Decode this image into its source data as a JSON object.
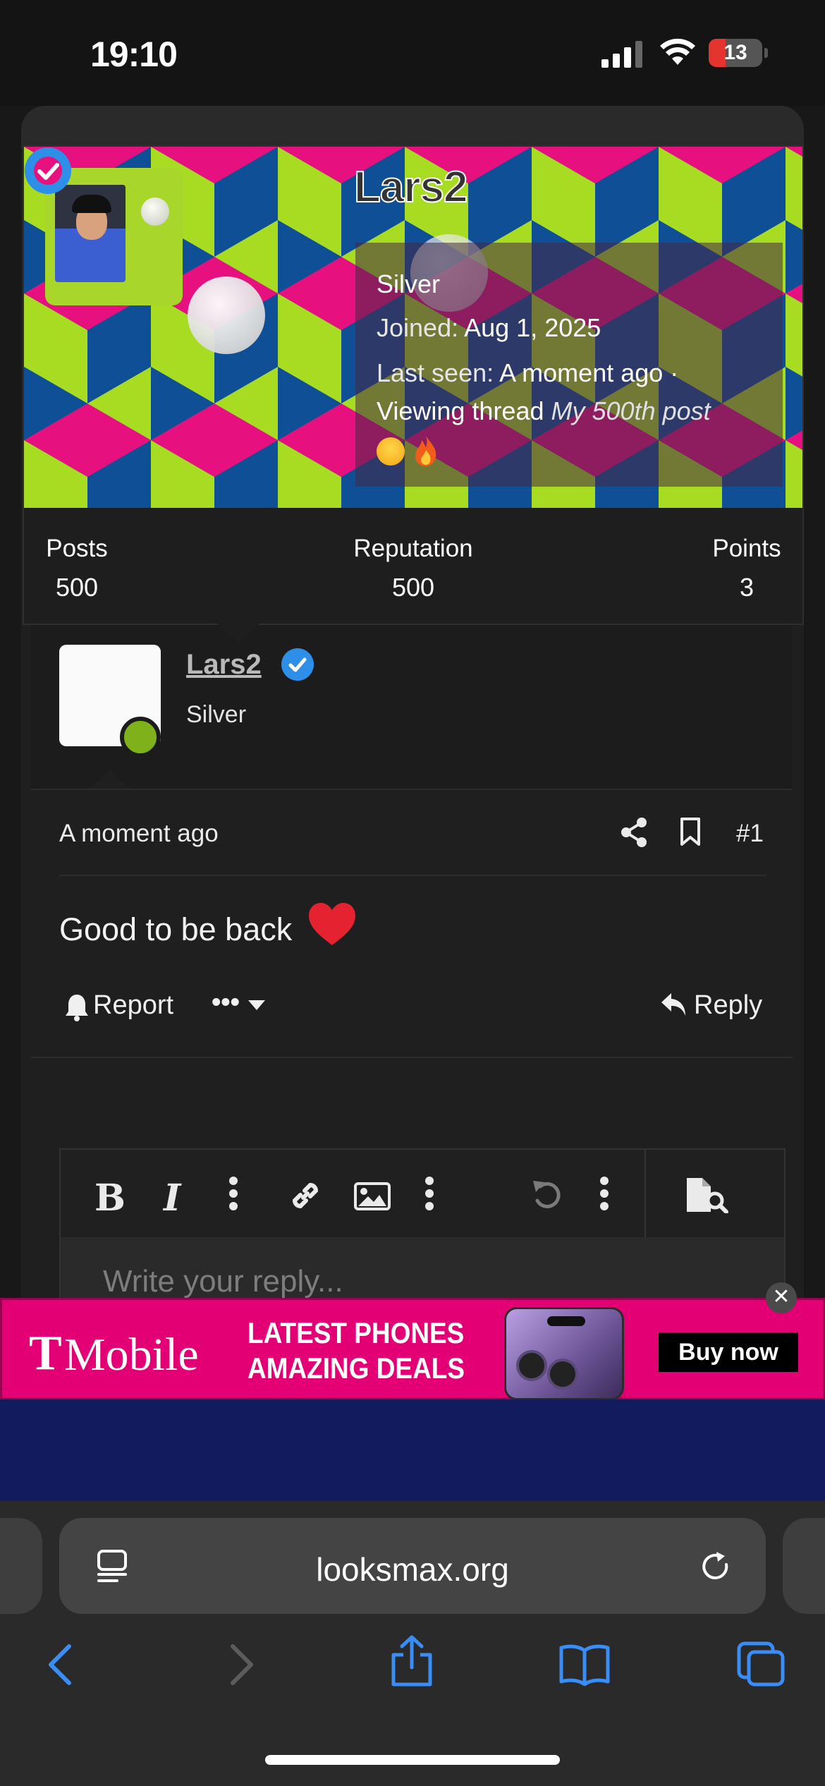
{
  "status_bar": {
    "time": "19:10",
    "battery": "13"
  },
  "profile_popup": {
    "username": "Lars2",
    "rank": "Silver",
    "joined_label": "Joined:",
    "joined_value": "Aug 1, 2025",
    "last_seen_label": "Last seen:",
    "last_seen_value": "A moment ago ·",
    "viewing_prefix": "Viewing thread",
    "viewing_thread": "My 500th post",
    "stats": [
      {
        "label": "Posts",
        "value": "500"
      },
      {
        "label": "Reputation",
        "value": "500"
      },
      {
        "label": "Points",
        "value": "3"
      }
    ],
    "colors": {
      "pink": "#e6117f",
      "lime": "#a8dc22",
      "blue": "#0e4f95"
    }
  },
  "post": {
    "username": "Lars2",
    "rank": "Silver",
    "time": "A moment ago",
    "number": "#1",
    "body": "Good to be back",
    "actions": {
      "report": "Report",
      "more": "•••",
      "reply": "Reply"
    }
  },
  "editor": {
    "placeholder": "Write your reply..."
  },
  "ad": {
    "brand": "Mobile",
    "line1": "LATEST PHONES",
    "line2": "AMAZING DEALS",
    "cta": "Buy now",
    "close": "✕"
  },
  "browser": {
    "url": "looksmax.org"
  }
}
